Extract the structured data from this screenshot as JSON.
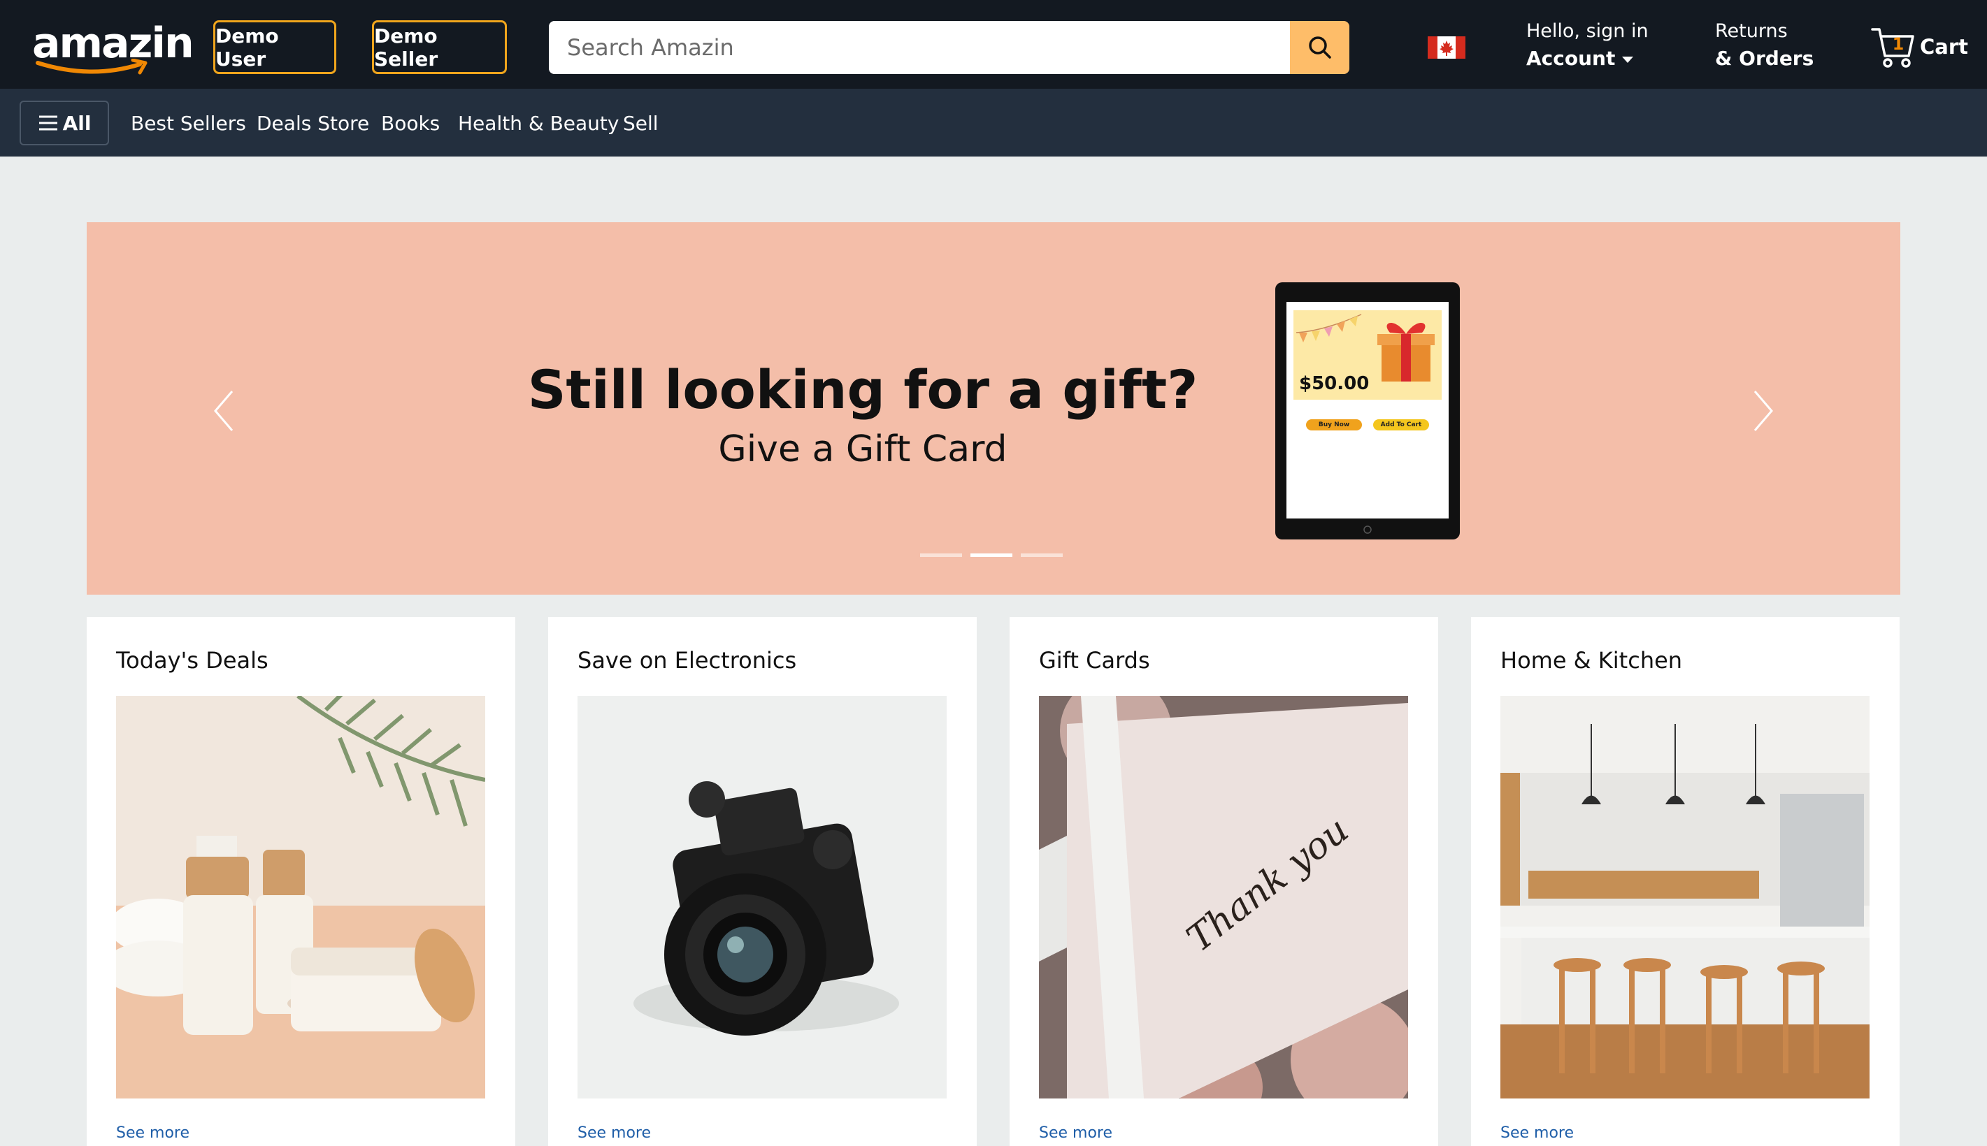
{
  "header": {
    "logo_text": "amazin",
    "demo_user_label": "Demo User",
    "demo_seller_label": "Demo Seller",
    "search_placeholder": "Search Amazin",
    "account_line1": "Hello, sign in",
    "account_line2": "Account",
    "orders_line1": "Returns",
    "orders_line2": "& Orders",
    "cart_count": "1",
    "cart_label": "Cart",
    "flag": "canada-flag-icon"
  },
  "nav": {
    "all_label": "All",
    "items": [
      "Best Sellers",
      "Deals Store",
      "Books",
      "Health & Beauty",
      "Sell"
    ]
  },
  "hero": {
    "headline": "Still looking for a gift?",
    "subheadline": "Give a Gift Card",
    "tablet_price": "$50.00",
    "tablet_buy_now": "Buy Now",
    "tablet_add_to_cart": "Add To Cart",
    "active_slide": 2,
    "slide_count": 3
  },
  "cards": [
    {
      "title": "Today's Deals",
      "link": "See more",
      "image": "skincare-products-image"
    },
    {
      "title": "Save on Electronics",
      "link": "See more",
      "image": "camera-image"
    },
    {
      "title": "Gift Cards",
      "link": "See more",
      "image": "thank-you-card-image"
    },
    {
      "title": "Home & Kitchen",
      "link": "See more",
      "image": "kitchen-image"
    }
  ],
  "colors": {
    "topbar": "#131921",
    "navbar": "#232f3e",
    "accent_orange": "#f0a51c",
    "search_button": "#febd69",
    "hero_bg": "#f4bea9",
    "link_blue": "#1f5ea8",
    "page_bg": "#eaeded"
  }
}
